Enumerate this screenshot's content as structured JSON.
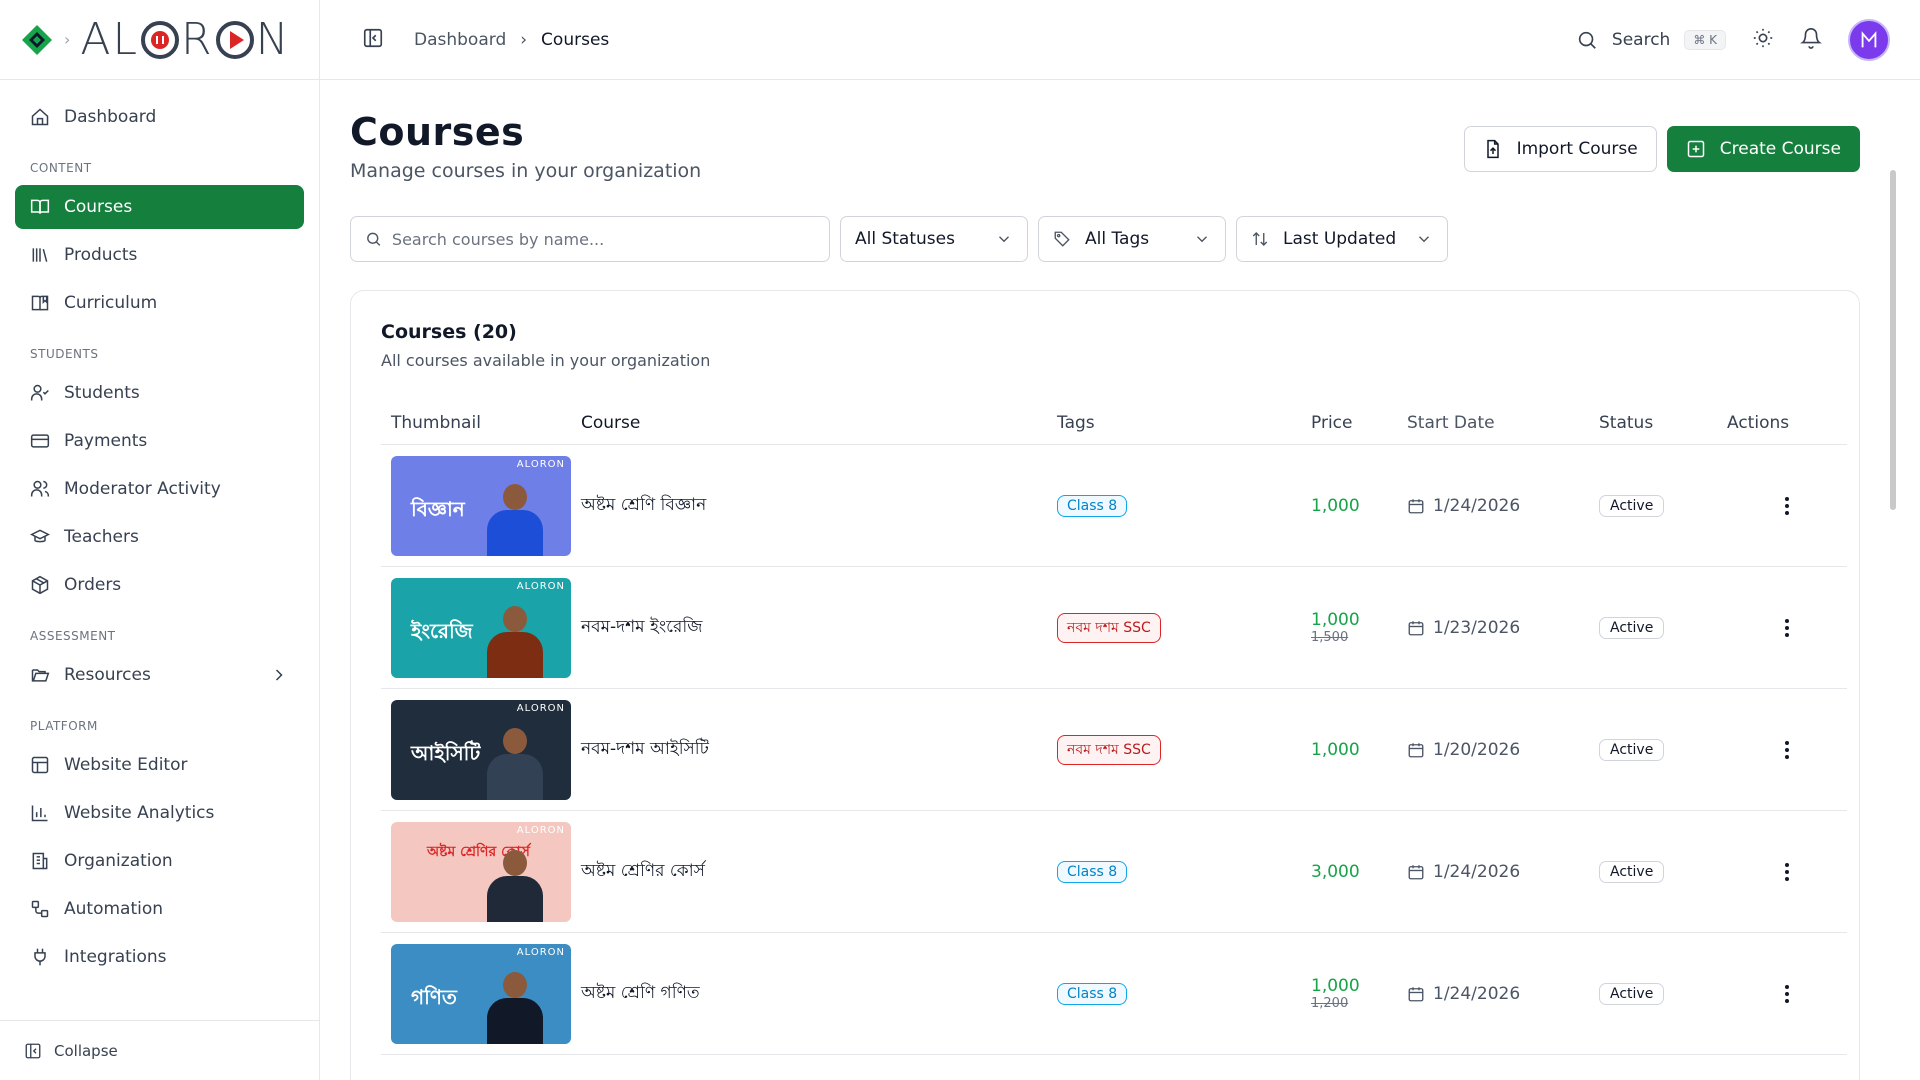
{
  "brand": {
    "logo_text_a": "A",
    "logo_text_l": "L",
    "logo_text_r": "R",
    "logo_text_n": "N"
  },
  "sidebar": {
    "dashboard": "Dashboard",
    "sections": {
      "content": "CONTENT",
      "students": "STUDENTS",
      "assessment": "ASSESSMENT",
      "platform": "PLATFORM"
    },
    "items": {
      "courses": "Courses",
      "products": "Products",
      "curriculum": "Curriculum",
      "students": "Students",
      "payments": "Payments",
      "moderator_activity": "Moderator Activity",
      "teachers": "Teachers",
      "orders": "Orders",
      "resources": "Resources",
      "website_editor": "Website Editor",
      "website_analytics": "Website Analytics",
      "organization": "Organization",
      "automation": "Automation",
      "integrations": "Integrations"
    },
    "collapse": "Collapse"
  },
  "topbar": {
    "breadcrumb": [
      "Dashboard",
      "Courses"
    ],
    "search_label": "Search",
    "search_kbd": "⌘ K"
  },
  "page": {
    "title": "Courses",
    "subtitle": "Manage courses in your organization",
    "import_label": "Import Course",
    "create_label": "Create Course"
  },
  "filters": {
    "search_placeholder": "Search courses by name...",
    "status": "All Statuses",
    "tags": "All Tags",
    "sort": "Last Updated"
  },
  "card": {
    "title": "Courses (20)",
    "subtitle": "All courses available in your organization"
  },
  "table": {
    "headers": [
      "Thumbnail",
      "Course",
      "Tags",
      "Price",
      "Start Date",
      "Status",
      "Actions"
    ],
    "rows": [
      {
        "thumb_title": "বিজ্ঞান",
        "thumb_brand": "ALORON",
        "name": "অষ্টম শ্রেণি বিজ্ঞান",
        "tag": "Class 8",
        "tag_color": "blue",
        "price": "1,000",
        "price_old": "",
        "date": "1/24/2026",
        "status": "Active",
        "thumb_bg": "#6f7fe8"
      },
      {
        "thumb_title": "ইংরেজি",
        "thumb_brand": "ALORON",
        "name": "নবম-দশম ইংরেজি",
        "tag": "নবম দশম SSC",
        "tag_color": "red",
        "price": "1,000",
        "price_old": "1,500",
        "date": "1/23/2026",
        "status": "Active",
        "thumb_bg": "#1aa3a8"
      },
      {
        "thumb_title": "আইসিটি",
        "thumb_brand": "ALORON",
        "name": "নবম-দশম আইসিটি",
        "tag": "নবম দশম SSC",
        "tag_color": "red",
        "price": "1,000",
        "price_old": "",
        "date": "1/20/2026",
        "status": "Active",
        "thumb_bg": "#1f2d3d"
      },
      {
        "thumb_title": "অষ্টম শ্রেণির কোর্স",
        "thumb_brand": "ALORON",
        "name": "অষ্টম শ্রেণির কোর্স",
        "tag": "Class 8",
        "tag_color": "blue",
        "price": "3,000",
        "price_old": "",
        "date": "1/24/2026",
        "status": "Active",
        "thumb_bg": "#f4c7c0"
      },
      {
        "thumb_title": "গণিত",
        "thumb_brand": "ALORON",
        "name": "অষ্টম শ্রেণি গণিত",
        "tag": "Class 8",
        "tag_color": "blue",
        "price": "1,000",
        "price_old": "1,200",
        "date": "1/24/2026",
        "status": "Active",
        "thumb_bg": "#3b8dc4"
      }
    ]
  },
  "colors": {
    "accent": "#15803d",
    "price": "#16a34a"
  }
}
